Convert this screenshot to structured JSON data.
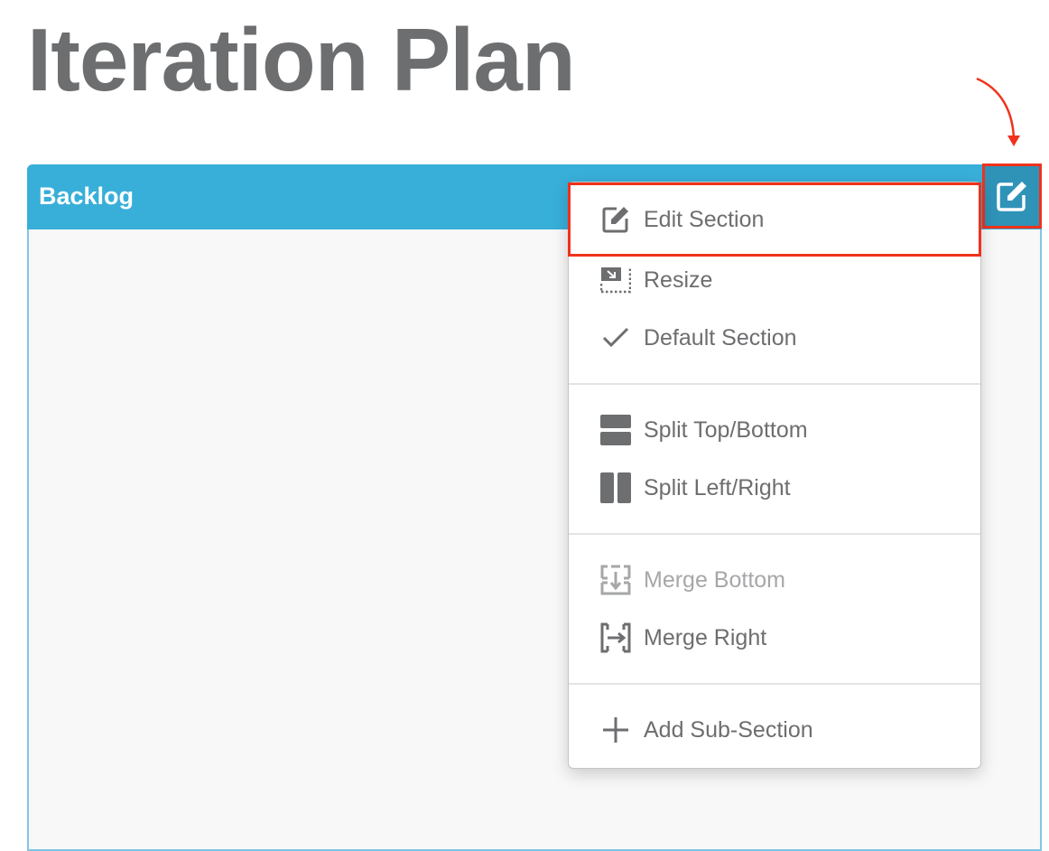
{
  "page": {
    "title": "Iteration Plan"
  },
  "section": {
    "title": "Backlog",
    "edit_button_icon": "edit-icon",
    "header_color": "#38afd9",
    "edit_button_color": "#2f93b8"
  },
  "annotation": {
    "highlight_color": "#f0321c",
    "arrow_icon": "curved-arrow-down-icon"
  },
  "menu": {
    "items": [
      {
        "label": "Edit Section",
        "icon": "edit-icon",
        "highlighted": true,
        "disabled": false
      },
      {
        "label": "Resize",
        "icon": "resize-icon",
        "highlighted": false,
        "disabled": false
      },
      {
        "label": "Default Section",
        "icon": "check-icon",
        "highlighted": false,
        "disabled": false
      },
      {
        "label": "Split Top/Bottom",
        "icon": "split-horizontal-icon",
        "highlighted": false,
        "disabled": false
      },
      {
        "label": "Split Left/Right",
        "icon": "split-vertical-icon",
        "highlighted": false,
        "disabled": false
      },
      {
        "label": "Merge Bottom",
        "icon": "merge-bottom-icon",
        "highlighted": false,
        "disabled": true
      },
      {
        "label": "Merge Right",
        "icon": "merge-right-icon",
        "highlighted": false,
        "disabled": false
      },
      {
        "label": "Add Sub-Section",
        "icon": "plus-icon",
        "highlighted": false,
        "disabled": false
      }
    ]
  }
}
